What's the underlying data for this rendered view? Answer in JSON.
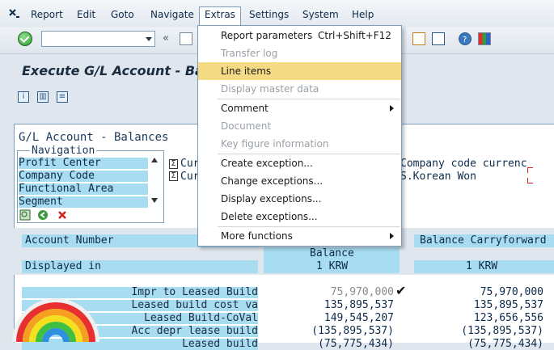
{
  "menubar": {
    "items": [
      "Report",
      "Edit",
      "Goto",
      "Navigate",
      "Extras",
      "Settings",
      "System",
      "Help"
    ],
    "active": "Extras"
  },
  "toolbar": {
    "command_value": "",
    "back_glyph": "«"
  },
  "title": "Execute G/L Account - Ba",
  "report": {
    "header": "G/L Account - Balances",
    "navigation_legend": "Navigation",
    "navigation_items": [
      "Profit Center",
      "Company Code",
      "Functional Area",
      "Segment"
    ],
    "info_left": [
      "Cur",
      "Cur"
    ],
    "info_right": [
      "Company code currenc",
      "S.Korean Won"
    ],
    "columns": {
      "account_number": "Account Number",
      "displayed_in": "Displayed in",
      "balance": "Balance",
      "balance_unit": "1 KRW",
      "carryforward": "Balance Carryforward",
      "carryforward_unit": "1 KRW"
    },
    "rows": [
      {
        "label": "Impr to Leased Build",
        "balance": "75,970,000",
        "carry": "75,970,000"
      },
      {
        "label": "Leased build cost va",
        "balance": "135,895,537",
        "carry": "135,895,537"
      },
      {
        "label": "Leased Build-CoVal",
        "balance": "149,545,207",
        "carry": "123,656,556"
      },
      {
        "label": "Acc depr lease build",
        "balance": "(135,895,537)",
        "carry": "(135,895,537)"
      },
      {
        "label": "Leased build",
        "balance": "(75,775,434)",
        "carry": "(75,775,434)"
      }
    ]
  },
  "extras_menu": {
    "items": [
      {
        "label": "Report parameters",
        "shortcut": "Ctrl+Shift+F12",
        "state": "enabled"
      },
      {
        "label": "Transfer log",
        "shortcut": "",
        "state": "disabled"
      },
      {
        "label": "Line items",
        "shortcut": "",
        "state": "highlighted"
      },
      {
        "label": "Display master data",
        "shortcut": "",
        "state": "disabled"
      },
      {
        "label": "Comment",
        "shortcut": "",
        "state": "enabled",
        "submenu": true
      },
      {
        "label": "Document",
        "shortcut": "",
        "state": "disabled"
      },
      {
        "label": "Key figure information",
        "shortcut": "",
        "state": "disabled"
      },
      {
        "label": "Create exception...",
        "shortcut": "",
        "state": "enabled"
      },
      {
        "label": "Change exceptions...",
        "shortcut": "",
        "state": "enabled"
      },
      {
        "label": "Display exceptions...",
        "shortcut": "",
        "state": "enabled"
      },
      {
        "label": "Delete exceptions...",
        "shortcut": "",
        "state": "enabled"
      },
      {
        "label": "More functions",
        "shortcut": "",
        "state": "enabled",
        "submenu": true
      }
    ]
  },
  "colors": {
    "highlight": "#f5dc84",
    "field_blue": "#a8dcf0",
    "disabled_text": "#9aa0a6"
  }
}
